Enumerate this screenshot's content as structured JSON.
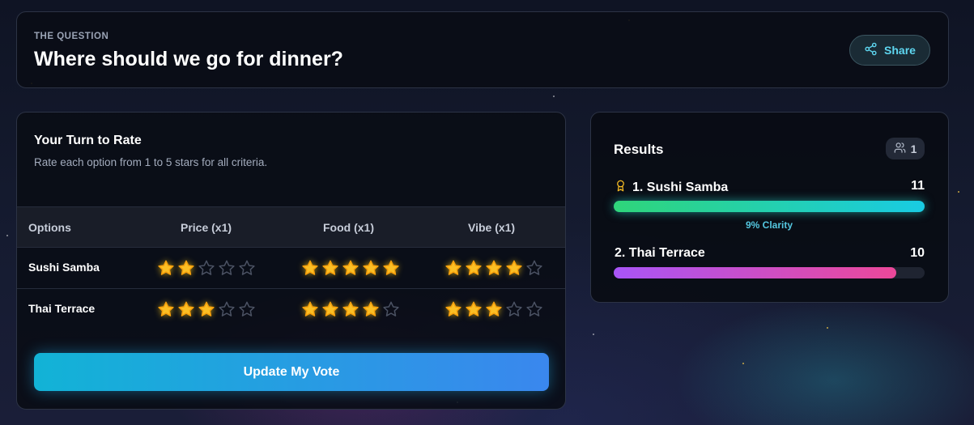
{
  "question": {
    "label": "THE QUESTION",
    "title": "Where should we go for dinner?",
    "share_label": "Share"
  },
  "rate": {
    "title": "Your Turn to Rate",
    "subtitle": "Rate each option from 1 to 5 stars for all criteria.",
    "columns": [
      "Options",
      "Price (x1)",
      "Food (x1)",
      "Vibe (x1)"
    ],
    "rows": [
      {
        "name": "Sushi Samba",
        "ratings": [
          2,
          5,
          4
        ]
      },
      {
        "name": "Thai Terrace",
        "ratings": [
          3,
          4,
          3
        ]
      }
    ],
    "max_stars": 5,
    "vote_button": "Update My Vote"
  },
  "results": {
    "title": "Results",
    "voter_count": "1",
    "items": [
      {
        "label": "1. Sushi Samba",
        "score": "11",
        "fill": 1.0
      },
      {
        "label": "2. Thai Terrace",
        "score": "10",
        "fill": 0.91
      }
    ],
    "clarity": "9% Clarity"
  },
  "colors": {
    "accent": "#5ed6f0",
    "star_on": "#fbbf24",
    "star_off": "#4b5263",
    "button_start": "#12b3d6",
    "button_end": "#3a87ee"
  }
}
